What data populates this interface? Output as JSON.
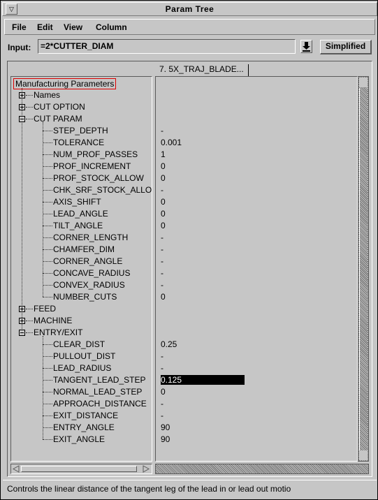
{
  "window": {
    "title": "Param Tree"
  },
  "menu": [
    "File",
    "Edit",
    "View",
    "Column"
  ],
  "input": {
    "label": "Input:",
    "value": "=2*CUTTER_DIAM"
  },
  "simplified_label": "Simplified",
  "column_header": "7. 5X_TRAJ_BLADE...",
  "tree": {
    "root": "Manufacturing Parameters",
    "groups": [
      {
        "label": "Names",
        "expanded": false
      },
      {
        "label": "CUT OPTION",
        "expanded": false
      },
      {
        "label": "CUT PARAM",
        "expanded": true,
        "params": [
          {
            "name": "STEP_DEPTH",
            "value": "-"
          },
          {
            "name": "TOLERANCE",
            "value": "0.001"
          },
          {
            "name": "NUM_PROF_PASSES",
            "value": "1"
          },
          {
            "name": "PROF_INCREMENT",
            "value": "0"
          },
          {
            "name": "PROF_STOCK_ALLOW",
            "value": "0"
          },
          {
            "name": "CHK_SRF_STOCK_ALLO",
            "value": "-"
          },
          {
            "name": "AXIS_SHIFT",
            "value": "0"
          },
          {
            "name": "LEAD_ANGLE",
            "value": "0"
          },
          {
            "name": "TILT_ANGLE",
            "value": "0"
          },
          {
            "name": "CORNER_LENGTH",
            "value": "-"
          },
          {
            "name": "CHAMFER_DIM",
            "value": "-"
          },
          {
            "name": "CORNER_ANGLE",
            "value": "-"
          },
          {
            "name": "CONCAVE_RADIUS",
            "value": "-"
          },
          {
            "name": "CONVEX_RADIUS",
            "value": "-"
          },
          {
            "name": "NUMBER_CUTS",
            "value": "0"
          }
        ]
      },
      {
        "label": "FEED",
        "expanded": false
      },
      {
        "label": "MACHINE",
        "expanded": false
      },
      {
        "label": "ENTRY/EXIT",
        "expanded": true,
        "params": [
          {
            "name": "CLEAR_DIST",
            "value": "0.25"
          },
          {
            "name": "PULLOUT_DIST",
            "value": "-"
          },
          {
            "name": "LEAD_RADIUS",
            "value": "-"
          },
          {
            "name": "TANGENT_LEAD_STEP",
            "value": "0.125",
            "selected": true
          },
          {
            "name": "NORMAL_LEAD_STEP",
            "value": "0"
          },
          {
            "name": "APPROACH_DISTANCE",
            "value": "-"
          },
          {
            "name": "EXIT_DISTANCE",
            "value": "-"
          },
          {
            "name": "ENTRY_ANGLE",
            "value": "90"
          },
          {
            "name": "EXIT_ANGLE",
            "value": "90"
          }
        ]
      }
    ]
  },
  "status": "Controls the linear distance of the tangent leg of the lead in or lead out motio"
}
